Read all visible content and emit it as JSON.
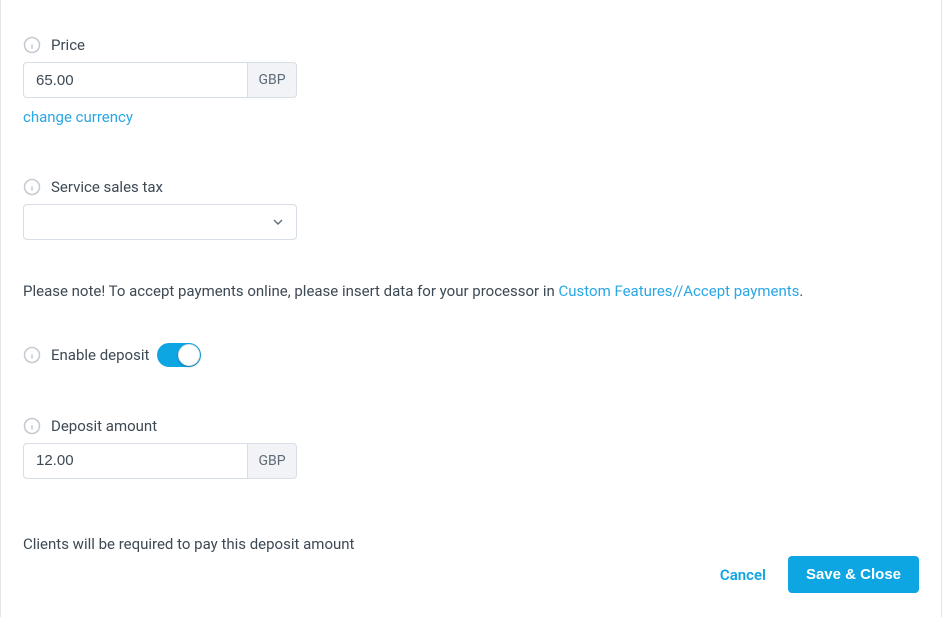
{
  "price": {
    "label": "Price",
    "value": "65.00",
    "currency": "GBP",
    "change_link": "change currency"
  },
  "sales_tax": {
    "label": "Service sales tax",
    "selected": ""
  },
  "note": {
    "prefix": "Please note! To accept payments online, please insert data for your processor in ",
    "link": "Custom Features//Accept payments",
    "suffix": "."
  },
  "deposit": {
    "enable_label": "Enable deposit",
    "enabled": true,
    "amount_label": "Deposit amount",
    "amount_value": "12.00",
    "amount_currency": "GBP",
    "hint": "Clients will be required to pay this deposit amount"
  },
  "actions": {
    "cancel": "Cancel",
    "save": "Save & Close"
  }
}
